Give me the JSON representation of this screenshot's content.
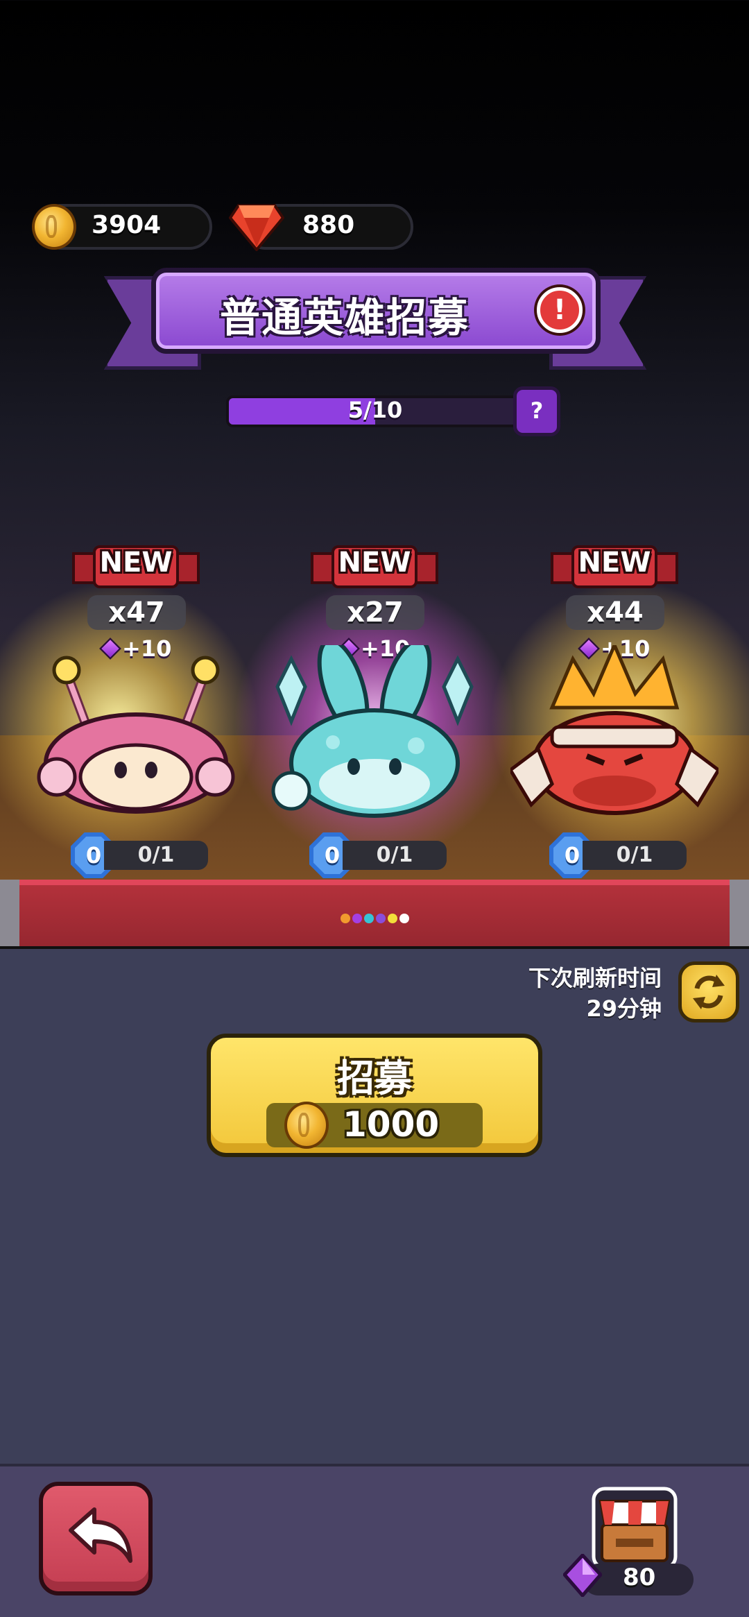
{
  "currency": {
    "gold": "3904",
    "gems": "880"
  },
  "banner": {
    "title": "普通英雄招募",
    "alert_symbol": "!"
  },
  "progress": {
    "text": "5/10",
    "fraction": 0.5,
    "help_symbol": "?"
  },
  "heroes": [
    {
      "badge": "NEW",
      "count": "x47",
      "bonus": "+10",
      "level": "0",
      "fragments": "0/1",
      "color": "#e4749f"
    },
    {
      "badge": "NEW",
      "count": "x27",
      "bonus": "+10",
      "level": "0",
      "fragments": "0/1",
      "color": "#6fd6d8"
    },
    {
      "badge": "NEW",
      "count": "x44",
      "bonus": "+10",
      "level": "0",
      "fragments": "0/1",
      "color": "#e4473f"
    }
  ],
  "page_indicator": {
    "colors": [
      "#f29a2e",
      "#a43fe3",
      "#37c4d6",
      "#8a4ddc",
      "#f2df3a",
      "#ffffff"
    ]
  },
  "refresh": {
    "label": "下次刷新时间",
    "time": "29分钟"
  },
  "recruit_button": {
    "label": "招募",
    "cost": "1000"
  },
  "shop": {
    "gem_count": "80"
  },
  "colors": {
    "accent_purple": "#8a48d0",
    "button_yellow": "#f2c73a",
    "back_red": "#c43e52"
  }
}
